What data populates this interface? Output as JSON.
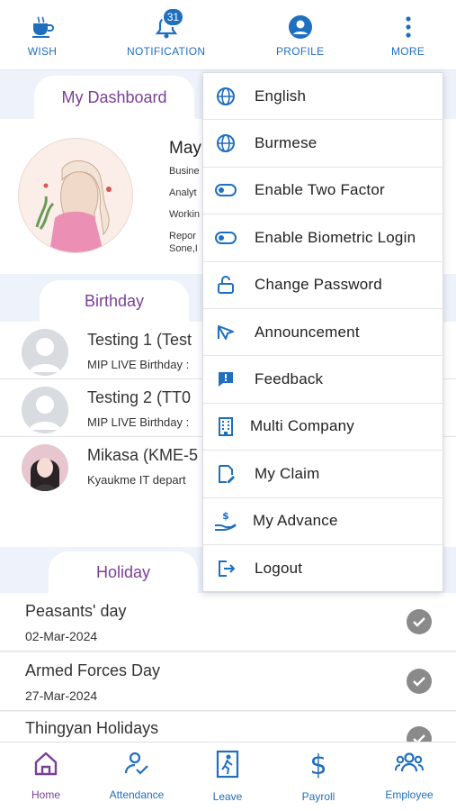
{
  "topbar": {
    "wish": "WISH",
    "notification": "NOTIFICATION",
    "notification_count": "31",
    "profile": "PROFILE",
    "more": "MORE"
  },
  "dashboard": {
    "tab": "My Dashboard",
    "name": "May",
    "line1": "Busine",
    "line2": "Analyt",
    "line3": "Workin",
    "line4": "Repor",
    "line5": "Sone,I"
  },
  "birthday": {
    "tab": "Birthday",
    "items": [
      {
        "title": "Testing 1 (Test",
        "sub": "MIP LIVE Birthday :"
      },
      {
        "title": "Testing 2 (TT0",
        "sub": "MIP LIVE Birthday :"
      },
      {
        "title": "Mikasa (KME-5",
        "sub": "Kyaukme IT depart"
      }
    ]
  },
  "holiday": {
    "tab": "Holiday",
    "items": [
      {
        "title": "Peasants' day",
        "date": "02-Mar-2024"
      },
      {
        "title": "Armed Forces Day",
        "date": "27-Mar-2024"
      },
      {
        "title": "Thingyan Holidays",
        "date": ""
      }
    ]
  },
  "menu": {
    "items": [
      {
        "label": "English",
        "icon": "globe-icon"
      },
      {
        "label": "Burmese",
        "icon": "globe-icon"
      },
      {
        "label": "Enable Two Factor",
        "icon": "toggle-icon"
      },
      {
        "label": "Enable Biometric Login",
        "icon": "toggle-icon"
      },
      {
        "label": "Change Password",
        "icon": "unlock-icon"
      },
      {
        "label": "Announcement",
        "icon": "megaphone-icon"
      },
      {
        "label": "Feedback",
        "icon": "feedback-icon"
      },
      {
        "label": "Multi Company",
        "icon": "building-icon"
      },
      {
        "label": "My Claim",
        "icon": "claim-icon"
      },
      {
        "label": "My Advance",
        "icon": "hand-money-icon"
      },
      {
        "label": "Logout",
        "icon": "logout-icon"
      }
    ]
  },
  "bottomnav": {
    "home": "Home",
    "attendance": "Attendance",
    "leave": "Leave",
    "payroll": "Payroll",
    "employee": "Employee"
  },
  "colors": {
    "accent_blue": "#1f6fbf",
    "accent_purple": "#7a3f97"
  }
}
